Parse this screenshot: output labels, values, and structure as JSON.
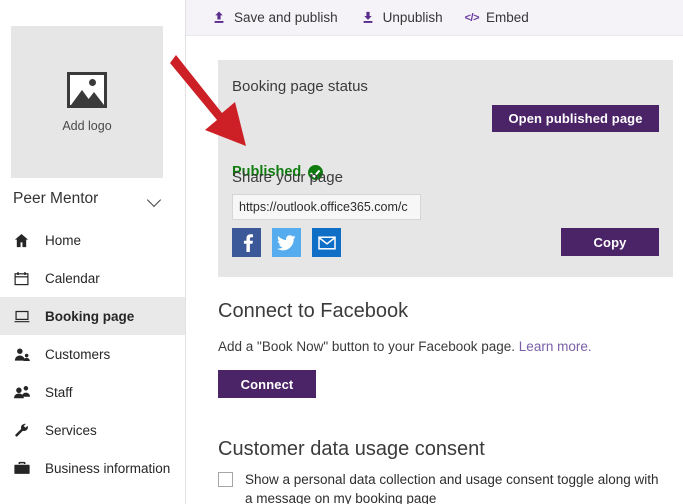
{
  "sidebar": {
    "logo": {
      "icon": "image-placeholder-icon",
      "caption": "Add logo"
    },
    "org": {
      "name": "Peer Mentor",
      "chevron": "chevron-down-icon"
    },
    "items": [
      {
        "label": "Home",
        "icon": "home-icon",
        "active": false
      },
      {
        "label": "Calendar",
        "icon": "calendar-icon",
        "active": false
      },
      {
        "label": "Booking page",
        "icon": "monitor-icon",
        "active": true
      },
      {
        "label": "Customers",
        "icon": "person-icon",
        "active": false
      },
      {
        "label": "Staff",
        "icon": "people-icon",
        "active": false
      },
      {
        "label": "Services",
        "icon": "wrench-icon",
        "active": false
      },
      {
        "label": "Business information",
        "icon": "briefcase-icon",
        "active": false
      }
    ]
  },
  "toolbar": {
    "buttons": [
      {
        "label": "Save and publish",
        "icon": "upload-icon"
      },
      {
        "label": "Unpublish",
        "icon": "download-icon"
      },
      {
        "label": "Embed",
        "icon": "code-icon",
        "glyph": "</>"
      }
    ]
  },
  "status_card": {
    "heading": "Booking page status",
    "status_text": "Published",
    "status_icon": "check-circle-icon",
    "open_published_label": "Open published page",
    "share_heading": "Share your page",
    "url_value": "https://outlook.office365.com/c",
    "social": [
      {
        "name": "facebook-share-icon",
        "label": "f"
      },
      {
        "name": "twitter-share-icon",
        "label": ""
      },
      {
        "name": "email-share-icon",
        "label": ""
      }
    ],
    "copy_label": "Copy"
  },
  "facebook_section": {
    "title": "Connect to Facebook",
    "description": "Add a \"Book Now\" button to your Facebook page.",
    "link_text": "Learn more.",
    "connect_label": "Connect"
  },
  "consent_section": {
    "title": "Customer data usage consent",
    "checkbox_label": "Show a personal data collection and usage consent toggle along with a message on my booking page",
    "checked": false
  },
  "annotation": {
    "arrow_color": "#CC2026",
    "name": "red-pointer-arrow"
  },
  "colors": {
    "accent_purple": "#4B2367",
    "toolbar_purple": "#5B2D8E",
    "published_green": "#107C10",
    "card_gray": "#E6E6E6",
    "facebook_blue": "#3B5998",
    "twitter_blue": "#55ACEE",
    "email_blue": "#0F6FC6",
    "link_purple": "#7A5FA8"
  }
}
